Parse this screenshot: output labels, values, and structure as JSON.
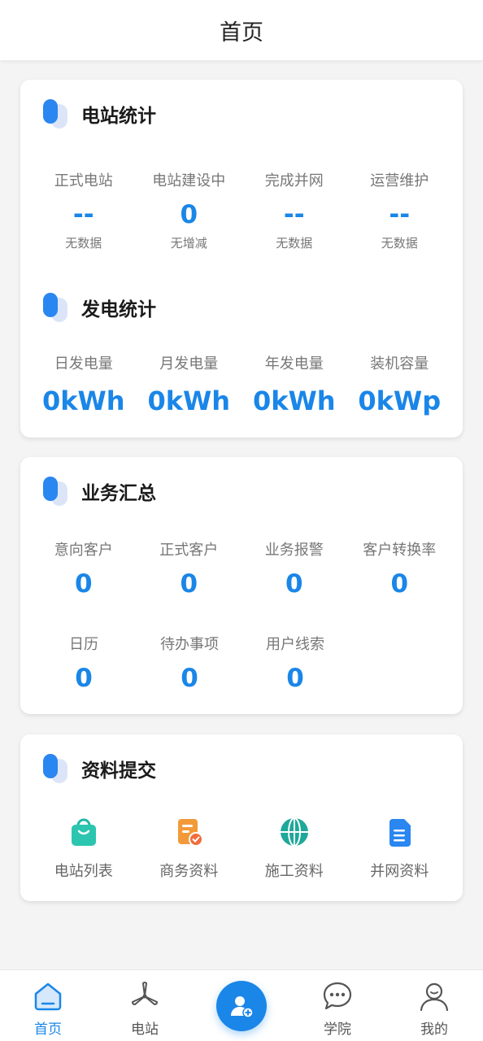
{
  "header": {
    "title": "首页"
  },
  "station_stats": {
    "title": "电站统计",
    "items": [
      {
        "label": "正式电站",
        "value": "--",
        "sub": "无数据"
      },
      {
        "label": "电站建设中",
        "value": "0",
        "sub": "无增减"
      },
      {
        "label": "完成并网",
        "value": "--",
        "sub": "无数据"
      },
      {
        "label": "运营维护",
        "value": "--",
        "sub": "无数据"
      }
    ]
  },
  "power_stats": {
    "title": "发电统计",
    "items": [
      {
        "label": "日发电量",
        "value": "0kWh"
      },
      {
        "label": "月发电量",
        "value": "0kWh"
      },
      {
        "label": "年发电量",
        "value": "0kWh"
      },
      {
        "label": "装机容量",
        "value": "0kWp"
      }
    ]
  },
  "business": {
    "title": "业务汇总",
    "row1": [
      {
        "label": "意向客户",
        "value": "0"
      },
      {
        "label": "正式客户",
        "value": "0"
      },
      {
        "label": "业务报警",
        "value": "0"
      },
      {
        "label": "客户转换率",
        "value": "0"
      }
    ],
    "row2": [
      {
        "label": "日历",
        "value": "0"
      },
      {
        "label": "待办事项",
        "value": "0"
      },
      {
        "label": "用户线索",
        "value": "0"
      }
    ]
  },
  "documents": {
    "title": "资料提交",
    "items": [
      {
        "label": "电站列表",
        "icon": "shopping-bag-icon"
      },
      {
        "label": "商务资料",
        "icon": "document-check-icon"
      },
      {
        "label": "施工资料",
        "icon": "globe-icon"
      },
      {
        "label": "并网资料",
        "icon": "file-text-icon"
      }
    ]
  },
  "tabbar": {
    "items": [
      {
        "label": "首页",
        "icon": "home-icon",
        "active": true
      },
      {
        "label": "电站",
        "icon": "wind-turbine-icon",
        "active": false
      },
      {
        "label": "",
        "icon": "add-user-icon",
        "active": false
      },
      {
        "label": "学院",
        "icon": "chat-bubble-icon",
        "active": false
      },
      {
        "label": "我的",
        "icon": "user-icon",
        "active": false
      }
    ]
  },
  "colors": {
    "accent": "#1a86e8",
    "background": "#f4f4f4",
    "card": "#ffffff"
  }
}
